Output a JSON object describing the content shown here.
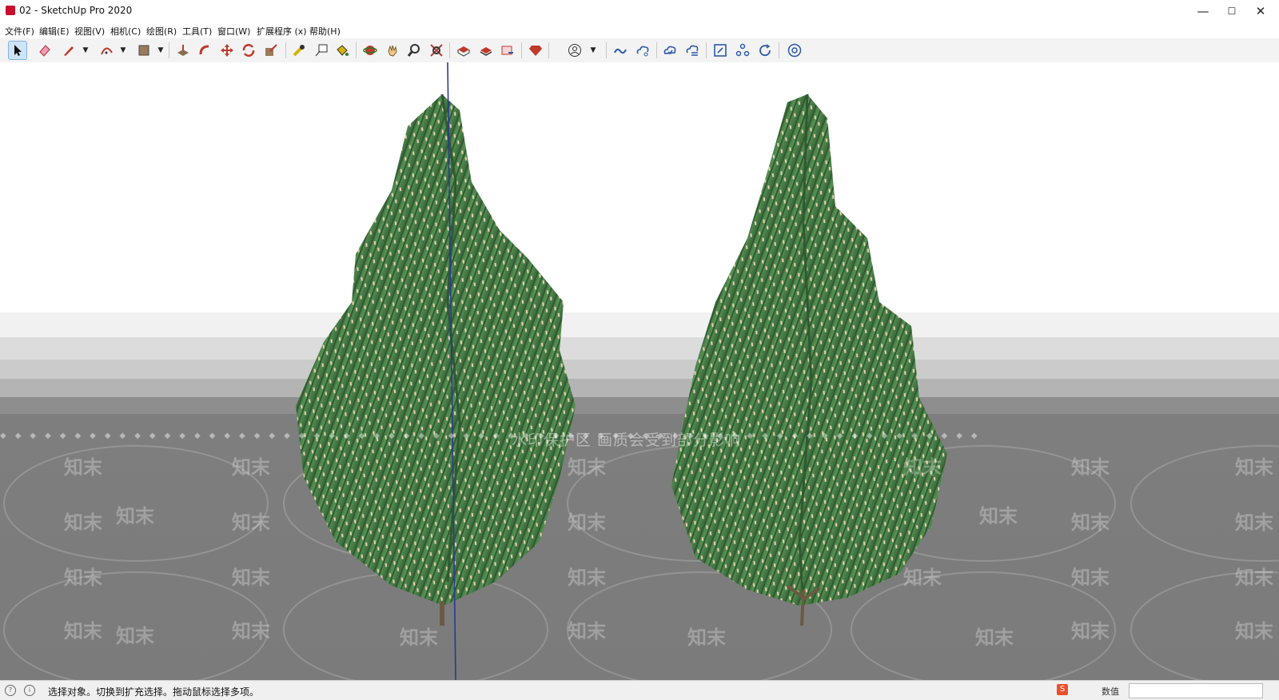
{
  "window": {
    "title": "02 - SketchUp Pro 2020",
    "minimize": "—",
    "maximize": "☐",
    "close": "✕"
  },
  "menu": [
    "文件(F)",
    "编辑(E)",
    "视图(V)",
    "相机(C)",
    "绘图(R)",
    "工具(T)",
    "窗口(W)",
    "扩展程序 (x)",
    "帮助(H)"
  ],
  "toolbar": {
    "tools": [
      "select-icon",
      "eraser-icon",
      "pencil-icon",
      "arc-icon",
      "rectangle-icon",
      "push-pull-icon",
      "follow-me-icon",
      "move-icon",
      "rotate-icon",
      "scale-icon",
      "tape-measure-icon",
      "text-icon",
      "paint-bucket-icon",
      "orbit-icon",
      "pan-icon",
      "zoom-icon",
      "zoom-extents-icon",
      "3d-warehouse-icon",
      "extension-warehouse-icon",
      "send-to-layout-icon",
      "extension-manager-icon",
      "account-icon",
      "trimble-connect-icon",
      "connect-share-icon",
      "cloud-sync-icon",
      "cloud-upload-icon",
      "frame-icon",
      "component-options-icon",
      "refresh-icon",
      "chrome-icon"
    ]
  },
  "viewport": {
    "watermark_center": "水印保护区   画质会受到部分影响",
    "watermark_text": "知末",
    "diamonds": "◆◆◆◆◆◆◆◆◆◆◆◆◆◆◆◆◆◆◆◆◆◆◆◆◆◆◆◆◆◆◆◆◆◆◆◆◆◆◆◆◆◆◆◆◆◆◆◆◆◆◆◆◆◆◆◆◆◆◆◆◆◆◆◆◆◆"
  },
  "status": {
    "message": "选择对象。切换到扩充选择。拖动鼠标选择多项。",
    "measurements_label": "数值",
    "measurements_value": ""
  },
  "colors": {
    "foliage_dark": "#3f6f3f",
    "foliage": "#4f8a4c",
    "foliage_light": "#6aa05f",
    "bud": "#e8d2b0",
    "trunk": "#6b5a42",
    "blue_axis": "#2a3a8f",
    "accent_selected": "#cfe4f7"
  }
}
